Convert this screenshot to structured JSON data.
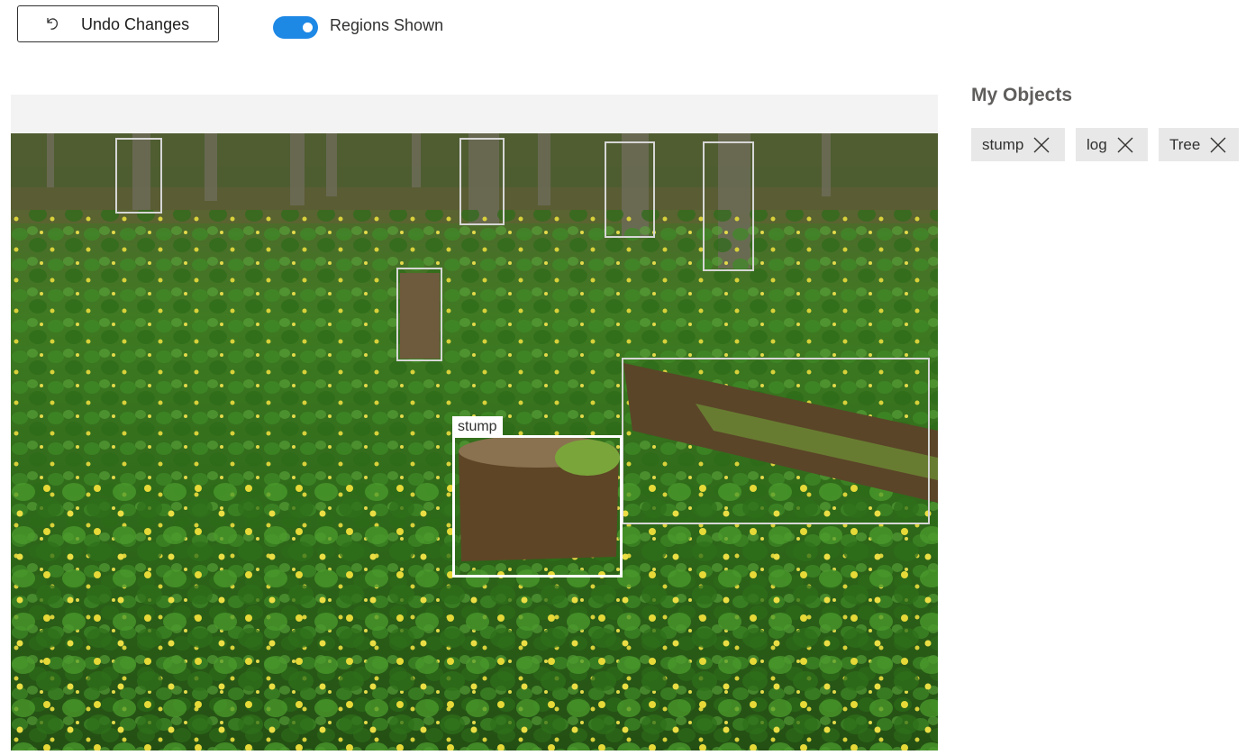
{
  "toolbar": {
    "undo_label": "Undo Changes",
    "toggle_label": "Regions Shown",
    "toggle_on": true
  },
  "canvas": {
    "selected_region_label": "stump"
  },
  "sidebar": {
    "title": "My Objects",
    "objects": [
      {
        "label": "stump"
      },
      {
        "label": "log"
      },
      {
        "label": "Tree"
      }
    ]
  },
  "colors": {
    "accent": "#1e88e5",
    "region_border": "#d6d6d6",
    "selected_region_border": "#ffffff",
    "chip_bg": "#e8e8e8"
  }
}
